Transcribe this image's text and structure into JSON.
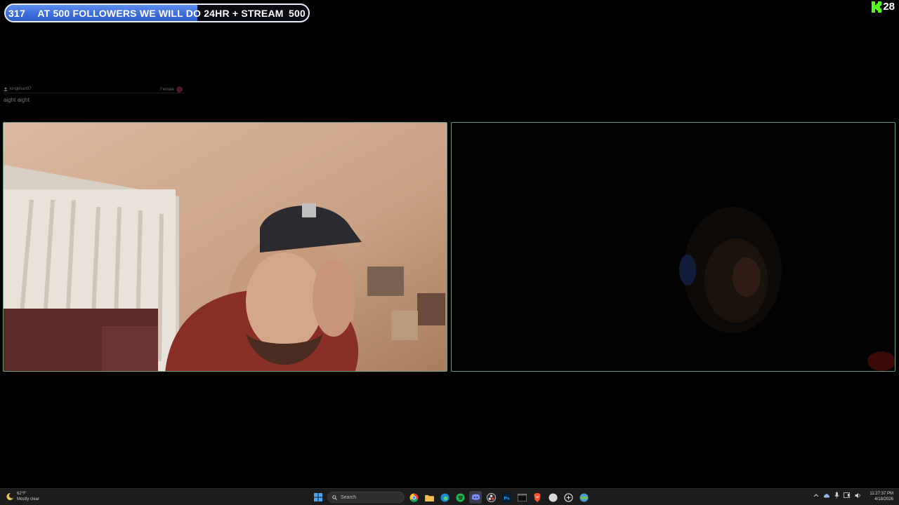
{
  "goal": {
    "current": "317",
    "text": "AT 500 FOLLOWERS WE WILL DO 24HR + STREAM",
    "target": "500",
    "progress": 0.634,
    "fill_color": "#3d6fdc"
  },
  "kick": {
    "icon": "kick-logo-icon",
    "count": "28",
    "color": "#53fc18"
  },
  "chat": {
    "username": "kingkhan97",
    "gender": "Female",
    "message": "aight aight"
  },
  "video": {
    "left_label": "webcam-feed-left",
    "right_label": "webcam-feed-right",
    "border_color": "#6f9a86"
  },
  "taskbar": {
    "weather_temp": "62°F",
    "weather_desc": "Mostly clear",
    "search_placeholder": "Search",
    "icons": [
      "windows-start-icon",
      "chrome-icon",
      "file-explorer-icon",
      "edge-icon",
      "spotify-icon",
      "discord-icon",
      "obs-icon",
      "photoshop-icon",
      "terminal-icon",
      "brave-icon",
      "app-icon",
      "app-icon-2",
      "app-icon-3"
    ],
    "time": "11:27:37 PM",
    "date": "4/18/2026"
  }
}
